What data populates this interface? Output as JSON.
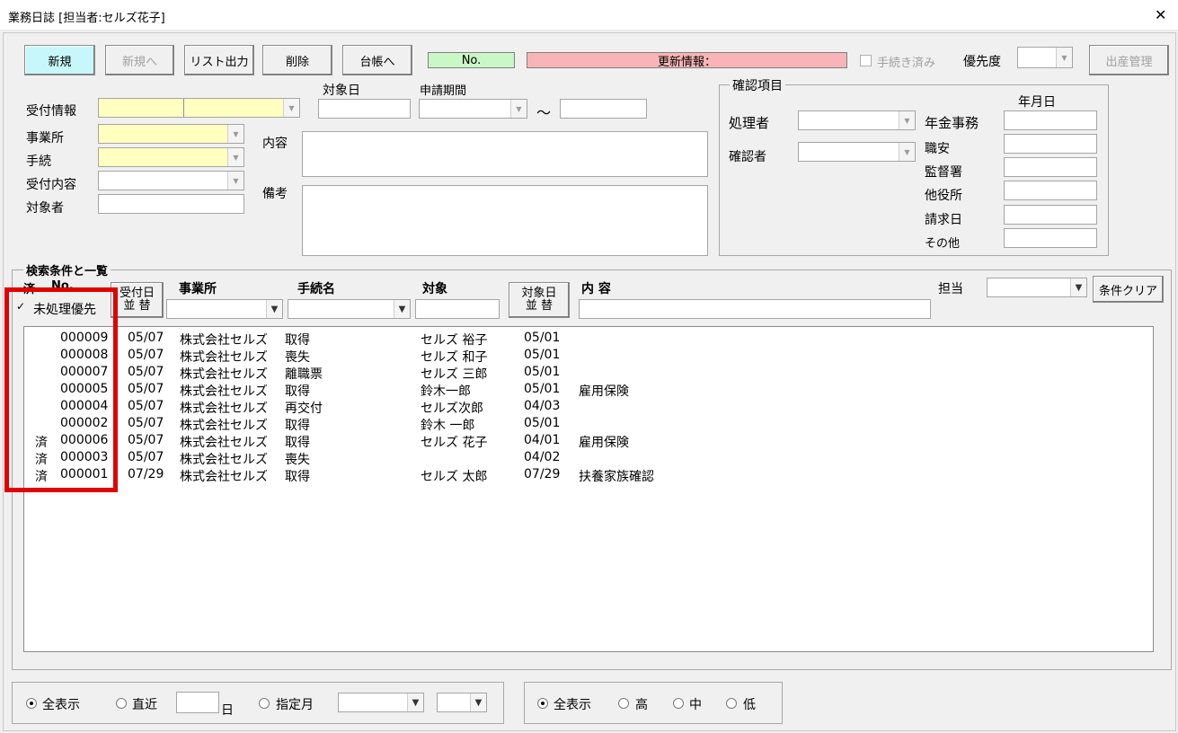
{
  "window": {
    "title": "業務日誌 [担当者:セルズ花子]",
    "close_glyph": "✕"
  },
  "toolbar": {
    "new": "新規",
    "to_new": "新規へ",
    "list_output": "リスト出力",
    "delete": "削除",
    "to_ledger": "台帳へ",
    "no_label": "No.",
    "update_info": "更新情報：",
    "procedure_done": "手続き済み",
    "priority": "優先度",
    "childbirth": "出産管理",
    "colors": {
      "new_button": "#c8f7fb",
      "no_box": "#c9f7c5",
      "update_box": "#f8b4b6"
    }
  },
  "form": {
    "reception_info": "受付情報",
    "target_date": "対象日",
    "application_period": "申請期間",
    "tilde": "～",
    "office": "事業所",
    "procedure": "手続",
    "content": "内容",
    "reception_content": "受付内容",
    "target_person": "対象者",
    "remarks": "備考"
  },
  "confirm": {
    "caption": "確認項目",
    "processor": "処理者",
    "confirmer": "確認者",
    "date_header": "年月日",
    "items": [
      "年金事務",
      "職安",
      "監督署",
      "他役所",
      "請求日",
      "その他"
    ]
  },
  "search": {
    "caption": "検索条件と一覧",
    "col_done": "済",
    "col_no": "No.",
    "reception_sort": [
      "受付日",
      "並 替"
    ],
    "col_office": "事業所",
    "col_procedure": "手続名",
    "col_target": "対象",
    "target_sort": [
      "対象日",
      "並 替"
    ],
    "col_content": "内 容",
    "assignee": "担当",
    "clear": "条件クリア",
    "unprocessed_first": "未処理優先",
    "checkmark": "✓"
  },
  "list_rows": [
    {
      "done": "",
      "no": "000009",
      "date": "05/07",
      "office": "株式会社セルズ",
      "procedure": "取得",
      "target": "セルズ 裕子",
      "target_date": "05/01",
      "content": ""
    },
    {
      "done": "",
      "no": "000008",
      "date": "05/07",
      "office": "株式会社セルズ",
      "procedure": "喪失",
      "target": "セルズ 和子",
      "target_date": "05/01",
      "content": ""
    },
    {
      "done": "",
      "no": "000007",
      "date": "05/07",
      "office": "株式会社セルズ",
      "procedure": "離職票",
      "target": "セルズ 三郎",
      "target_date": "05/01",
      "content": ""
    },
    {
      "done": "",
      "no": "000005",
      "date": "05/07",
      "office": "株式会社セルズ",
      "procedure": "取得",
      "target": "鈴木一郎",
      "target_date": "05/01",
      "content": "雇用保険"
    },
    {
      "done": "",
      "no": "000004",
      "date": "05/07",
      "office": "株式会社セルズ",
      "procedure": "再交付",
      "target": "セルズ次郎",
      "target_date": "04/03",
      "content": ""
    },
    {
      "done": "",
      "no": "000002",
      "date": "05/07",
      "office": "株式会社セルズ",
      "procedure": "取得",
      "target": "鈴木 一郎",
      "target_date": "05/01",
      "content": ""
    },
    {
      "done": "済",
      "no": "000006",
      "date": "05/07",
      "office": "株式会社セルズ",
      "procedure": "取得",
      "target": "セルズ 花子",
      "target_date": "04/01",
      "content": "雇用保険"
    },
    {
      "done": "済",
      "no": "000003",
      "date": "05/07",
      "office": "株式会社セルズ",
      "procedure": "喪失",
      "target": "",
      "target_date": "04/02",
      "content": ""
    },
    {
      "done": "済",
      "no": "000001",
      "date": "07/29",
      "office": "株式会社セルズ",
      "procedure": "取得",
      "target": "セルズ 太郎",
      "target_date": "07/29",
      "content": "扶養家族確認"
    }
  ],
  "filters": {
    "show_all": "全表示",
    "recent": "直近",
    "day_unit": "日",
    "specified_month": "指定月",
    "priority_all": "全表示",
    "high": "高",
    "mid": "中",
    "low": "低"
  }
}
